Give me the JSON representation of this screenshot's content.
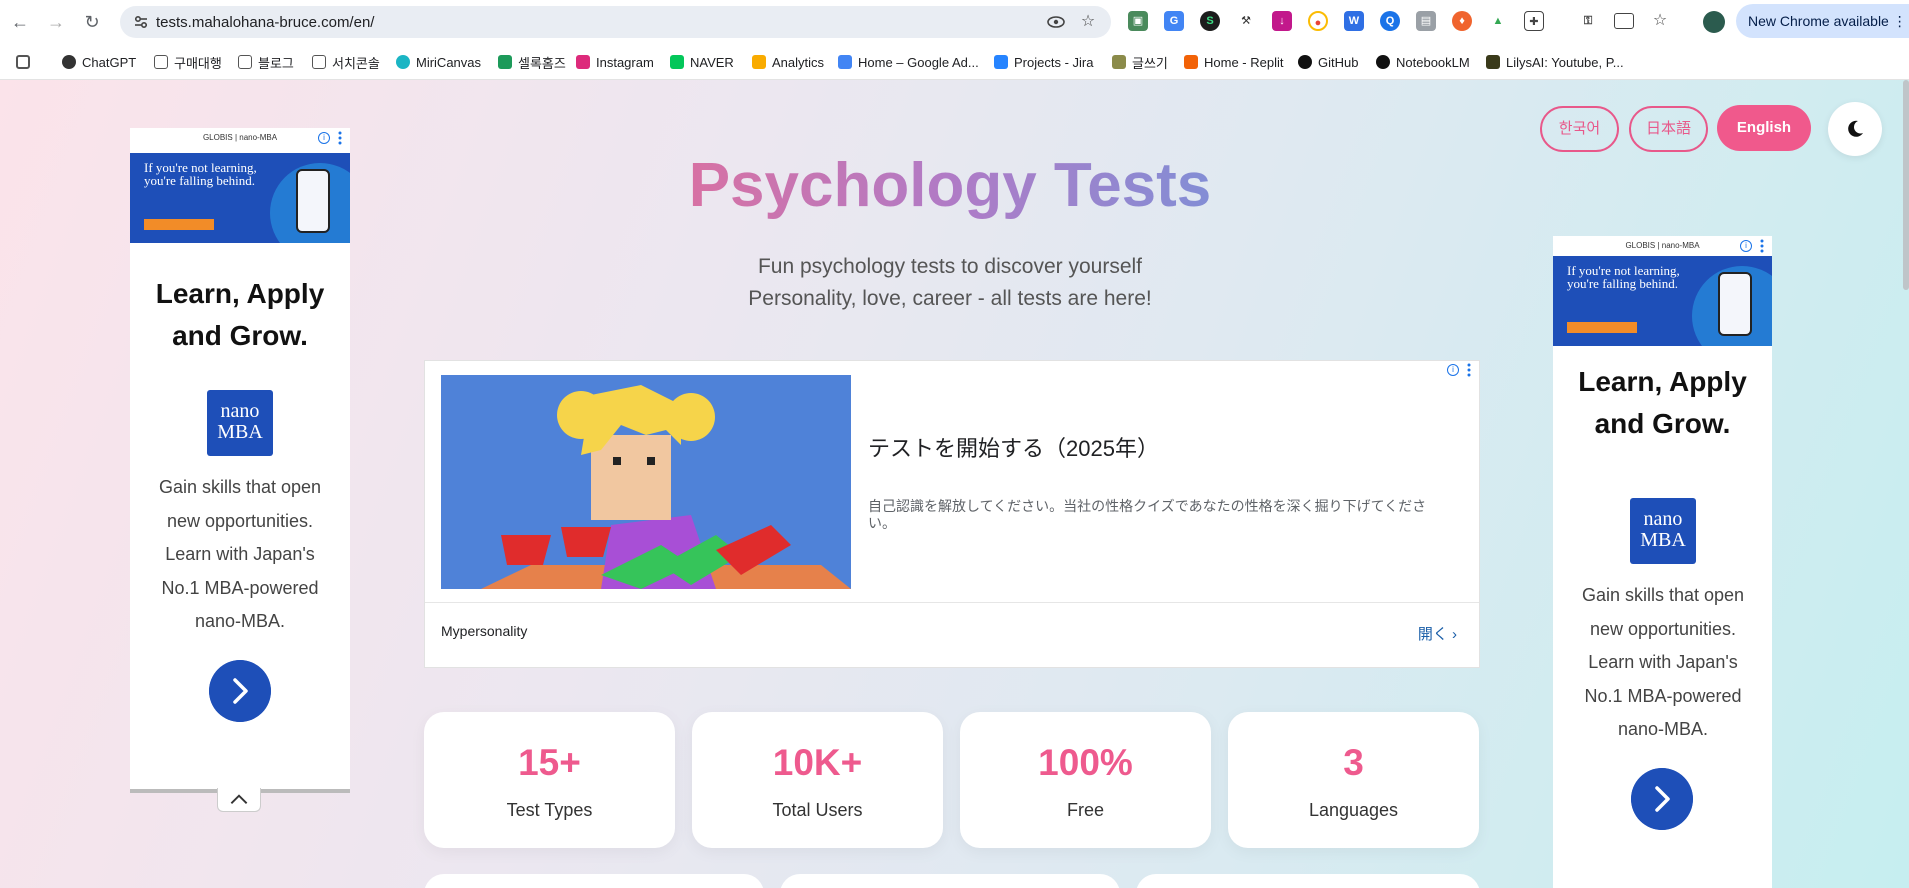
{
  "browser": {
    "url": "tests.mahalohana-bruce.com/en/",
    "update_label": "New Chrome available",
    "bookmarks": [
      "ChatGPT",
      "구매대행",
      "블로그",
      "서치콘솔",
      "MiriCanvas",
      "셀록홈즈",
      "Instagram",
      "NAVER",
      "Analytics",
      "Home – Google Ad...",
      "Projects - Jira",
      "글쓰기",
      "Home - Replit",
      "GitHub",
      "NotebookLM",
      "LilysAI: Youtube, P..."
    ]
  },
  "languages": [
    "한국어",
    "日本語",
    "English"
  ],
  "hero": {
    "title": "Psychology Tests",
    "subtitle_1": "Fun psychology tests to discover yourself",
    "subtitle_2": "Personality, love, career - all tests are here!"
  },
  "side_ad": {
    "header": "GLOBIS | nano-MBA",
    "banner_text": "If you're not learning, you're falling behind.",
    "heading_line_1": "Learn, Apply",
    "heading_line_2": "and Grow.",
    "logo_line_1": "nano",
    "logo_line_2": "MBA",
    "desc_lines": [
      "Gain skills that open",
      "new opportunities.",
      "Learn with Japan's",
      "No.1 MBA-powered",
      "nano-MBA."
    ]
  },
  "center_ad": {
    "title": "テストを開始する（2025年）",
    "description": "自己認識を解放してください。当社の性格クイズであなたの性格を深く掘り下げてください。",
    "brand": "Mypersonality",
    "open_label": "開く"
  },
  "stats": [
    {
      "value": "15+",
      "label": "Test Types"
    },
    {
      "value": "10K+",
      "label": "Total Users"
    },
    {
      "value": "100%",
      "label": "Free"
    },
    {
      "value": "3",
      "label": "Languages"
    }
  ],
  "colors": {
    "accent_pink": "#ee5a8e",
    "ad_blue": "#1e4fb8"
  }
}
